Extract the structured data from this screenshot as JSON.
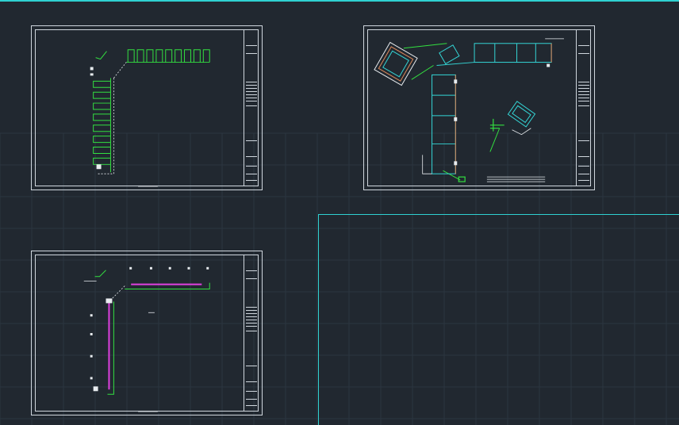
{
  "app": {
    "name": "",
    "viewport_bg": "#212830",
    "accent": "#2fd1d1",
    "line_color": "#cfd6dd",
    "grid_color": "#2c3640"
  },
  "sheets": [
    {
      "id": "sheet-1",
      "content": "l-shaped-layout-green-fixtures"
    },
    {
      "id": "sheet-2",
      "content": "pipe-routing-plan-cyan-blocks"
    },
    {
      "id": "sheet-3",
      "content": "l-shaped-layout-magenta-run"
    }
  ],
  "colors": {
    "green": "#33e040",
    "cyan": "#34d6d6",
    "magenta": "#e040e0",
    "white": "#e8ecef",
    "orange": "#e08a5a"
  }
}
